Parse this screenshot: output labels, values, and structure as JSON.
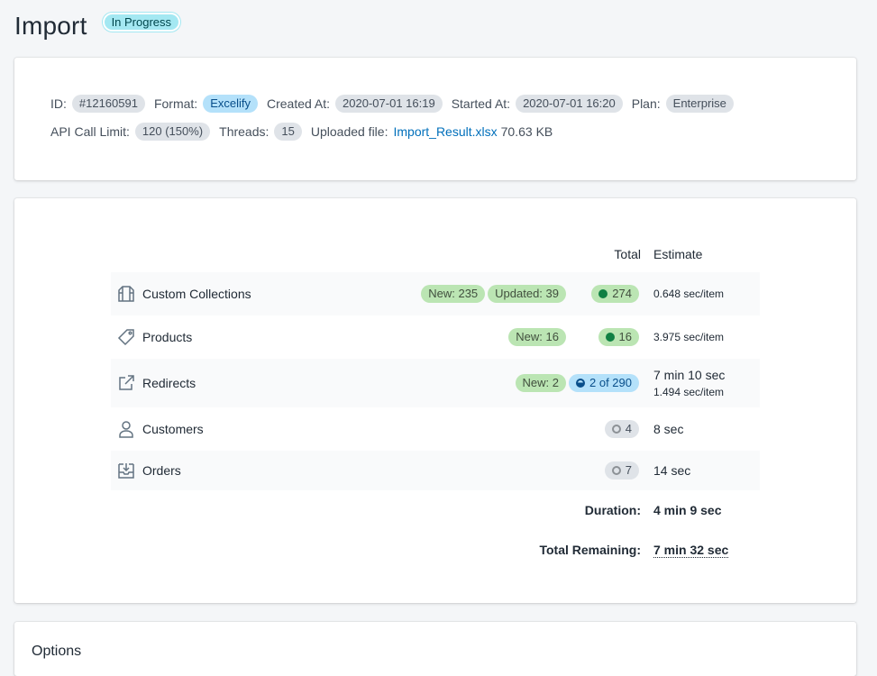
{
  "page": {
    "title": "Import",
    "status": "In Progress"
  },
  "info": {
    "id_label": "ID:",
    "id_value": "#12160591",
    "format_label": "Format:",
    "format_value": "Excelify",
    "created_label": "Created At:",
    "created_value": "2020-07-01 16:19",
    "started_label": "Started At:",
    "started_value": "2020-07-01 16:20",
    "plan_label": "Plan:",
    "plan_value": "Enterprise",
    "api_label": "API Call Limit:",
    "api_value": "120 (150%)",
    "threads_label": "Threads:",
    "threads_value": "15",
    "file_label": "Uploaded file:",
    "file_name": "Import_Result.xlsx",
    "file_size": "70.63 KB"
  },
  "progress": {
    "header_total": "Total",
    "header_estimate": "Estimate",
    "rows": [
      {
        "name": "Custom Collections",
        "icon": "collection-icon",
        "badges": [
          "New: 235",
          "Updated: 39"
        ],
        "total": "274",
        "total_state": "complete",
        "estimate_main": "",
        "estimate_rate": "0.648 sec/item"
      },
      {
        "name": "Products",
        "icon": "tag-icon",
        "badges": [
          "New: 16"
        ],
        "total": "16",
        "total_state": "complete",
        "estimate_main": "",
        "estimate_rate": "3.975 sec/item"
      },
      {
        "name": "Redirects",
        "icon": "external-link-icon",
        "badges": [
          "New: 2"
        ],
        "total": "2 of 290",
        "total_state": "in-progress",
        "estimate_main": "7 min 10 sec",
        "estimate_rate": "1.494 sec/item"
      },
      {
        "name": "Customers",
        "icon": "person-icon",
        "badges": [],
        "total": "4",
        "total_state": "pending",
        "estimate_main": "8 sec",
        "estimate_rate": ""
      },
      {
        "name": "Orders",
        "icon": "inbox-download-icon",
        "badges": [],
        "total": "7",
        "total_state": "pending",
        "estimate_main": "14 sec",
        "estimate_rate": ""
      }
    ],
    "duration_label": "Duration:",
    "duration_value": "4 min 9 sec",
    "remaining_label": "Total Remaining:",
    "remaining_value": "7 min 32 sec"
  },
  "options": {
    "title": "Options"
  },
  "colors": {
    "status_pill": "#a4e8f2",
    "green_badge": "#bbe5b3",
    "blue_badge": "#b4e1fa",
    "gray_badge": "#dfe3e8",
    "link": "#006fbb",
    "complete_dot": "#108043"
  }
}
